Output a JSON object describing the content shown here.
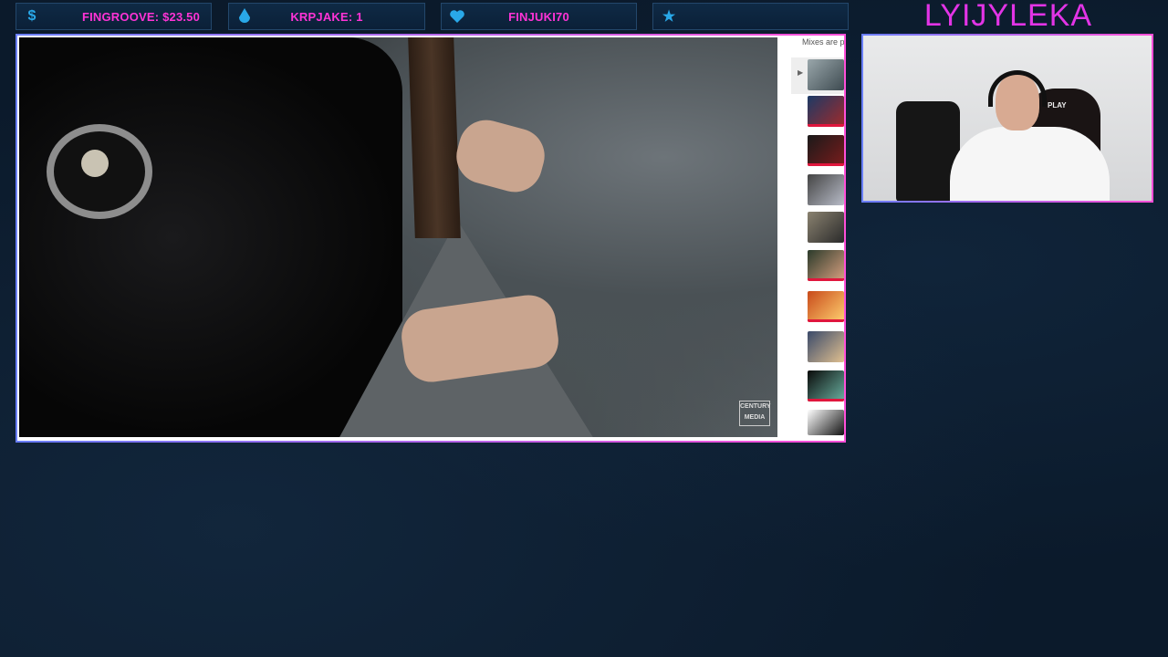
{
  "overlay": {
    "stats": [
      {
        "icon": "dollar-icon",
        "text": "FINGROOVE: $23.50"
      },
      {
        "icon": "drop-icon",
        "text": "KRPJAKE: 1"
      },
      {
        "icon": "heart-icon",
        "text": "FINJUKI70"
      },
      {
        "icon": "star-icon",
        "text": ""
      }
    ],
    "channel_name": "LYIJYLEKA",
    "accent_colors": {
      "pink": "#ff33d6",
      "blue": "#29a8e8",
      "border_start": "#6a7fff",
      "border_end": "#ff4fd8"
    }
  },
  "video": {
    "watermark": "CENTURY MEDIA",
    "side_panel": {
      "mixes_label": "Mixes are p",
      "play_icon": "play-icon",
      "thumbnails": 10
    }
  },
  "webcam": {
    "chair_logo": "PLAY"
  }
}
